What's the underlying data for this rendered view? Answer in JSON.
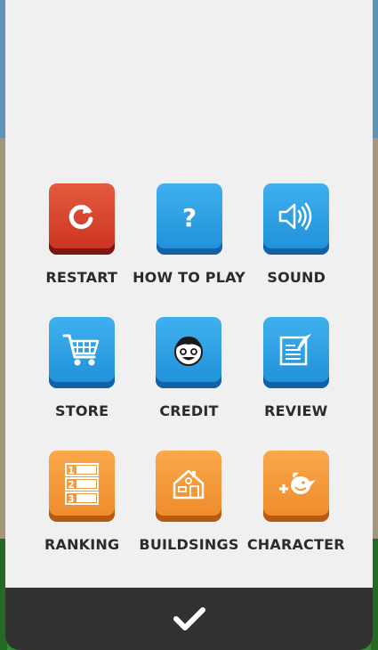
{
  "menu": {
    "items": [
      {
        "label": "RESTART",
        "icon": "restart-icon",
        "color": "red"
      },
      {
        "label": "HOW TO PLAY",
        "icon": "question-icon",
        "color": "blue"
      },
      {
        "label": "SOUND",
        "icon": "speaker-icon",
        "color": "blue"
      },
      {
        "label": "STORE",
        "icon": "cart-icon",
        "color": "blue"
      },
      {
        "label": "CREDIT",
        "icon": "face-icon",
        "color": "blue"
      },
      {
        "label": "REVIEW",
        "icon": "document-quill-icon",
        "color": "blue"
      },
      {
        "label": "RANKING",
        "icon": "ranking-list-icon",
        "color": "orange"
      },
      {
        "label": "BUILDSINGS",
        "icon": "house-icon",
        "color": "orange"
      },
      {
        "label": "CHARACTER",
        "icon": "add-bird-icon",
        "color": "orange"
      }
    ],
    "ranking_numbers": [
      "1",
      "2",
      "3"
    ]
  },
  "footer": {
    "confirm_icon": "checkmark-icon"
  },
  "colors": {
    "red": "#d9402c",
    "blue": "#2a9fe3",
    "orange": "#f39a38",
    "panel": "#f0f0f0",
    "footer": "#323232"
  }
}
